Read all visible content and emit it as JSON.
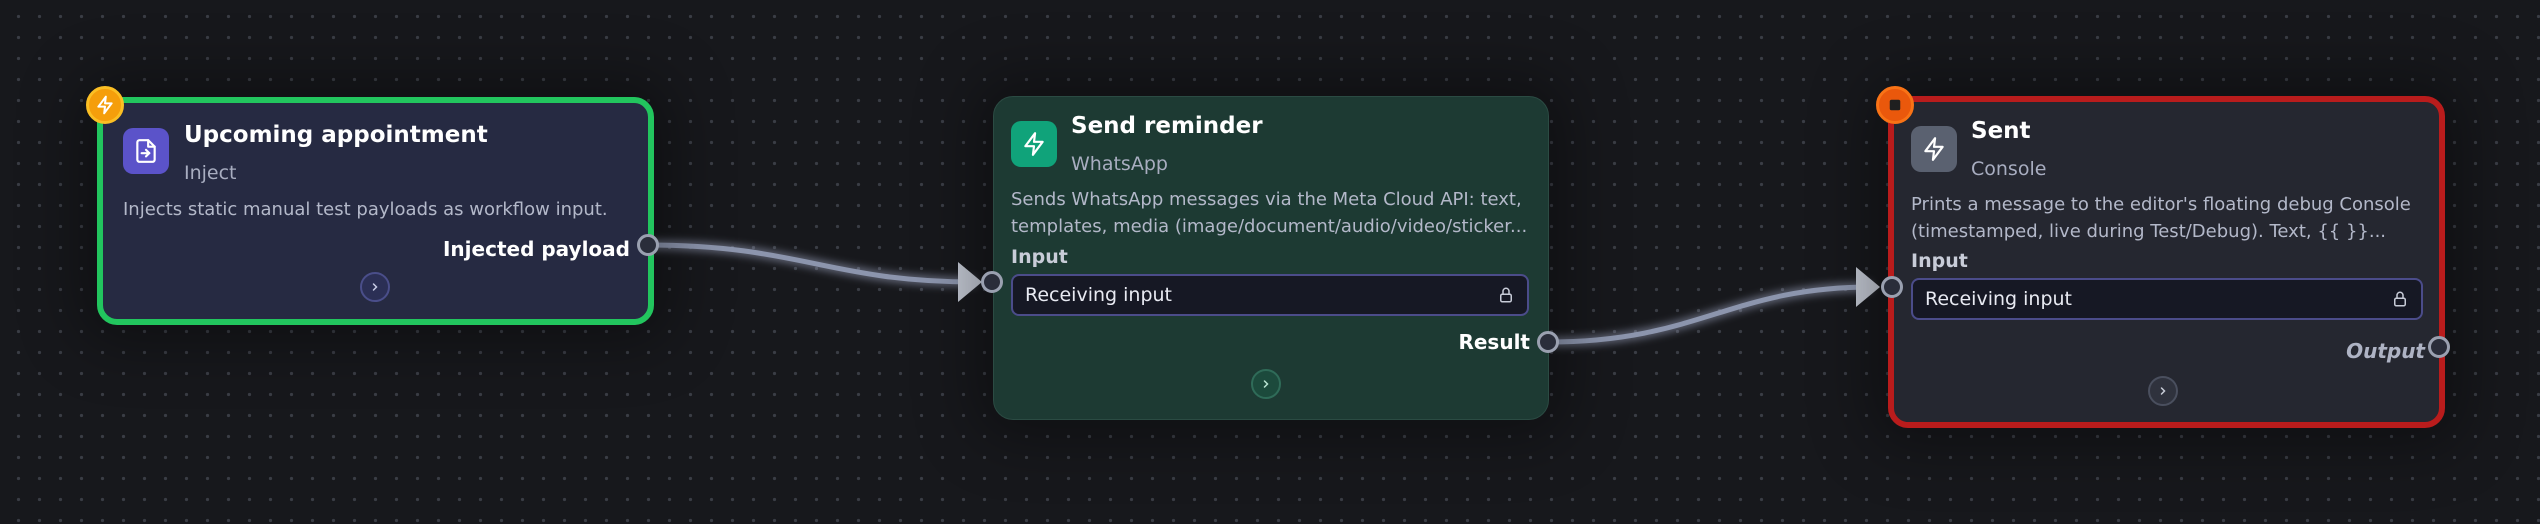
{
  "canvas": {
    "nodes": {
      "inject": {
        "title": "Upcoming appointment",
        "subtitle": "Inject",
        "description": "Injects static manual test payloads as workflow input.",
        "output_label": "Injected payload",
        "border_color": "#22c55e",
        "icon": "file-import-icon",
        "badge_icon": "lightning-icon"
      },
      "whatsapp": {
        "title": "Send reminder",
        "subtitle": "WhatsApp",
        "description": "Sends WhatsApp messages via the Meta Cloud API: text, templates, media (image/document/audio/video/sticker...",
        "input_label": "Input",
        "input_value": "Receiving input",
        "output_label": "Result",
        "icon": "lightning-icon"
      },
      "console": {
        "title": "Sent",
        "subtitle": "Console",
        "description": "Prints a message to the editor's floating debug Console (timestamped, live during Test/Debug). Text, {{ }}...",
        "input_label": "Input",
        "input_value": "Receiving input",
        "output_label": "Output",
        "border_color": "#b91c1c",
        "icon": "lightning-icon",
        "badge_icon": "stop-icon"
      }
    }
  }
}
